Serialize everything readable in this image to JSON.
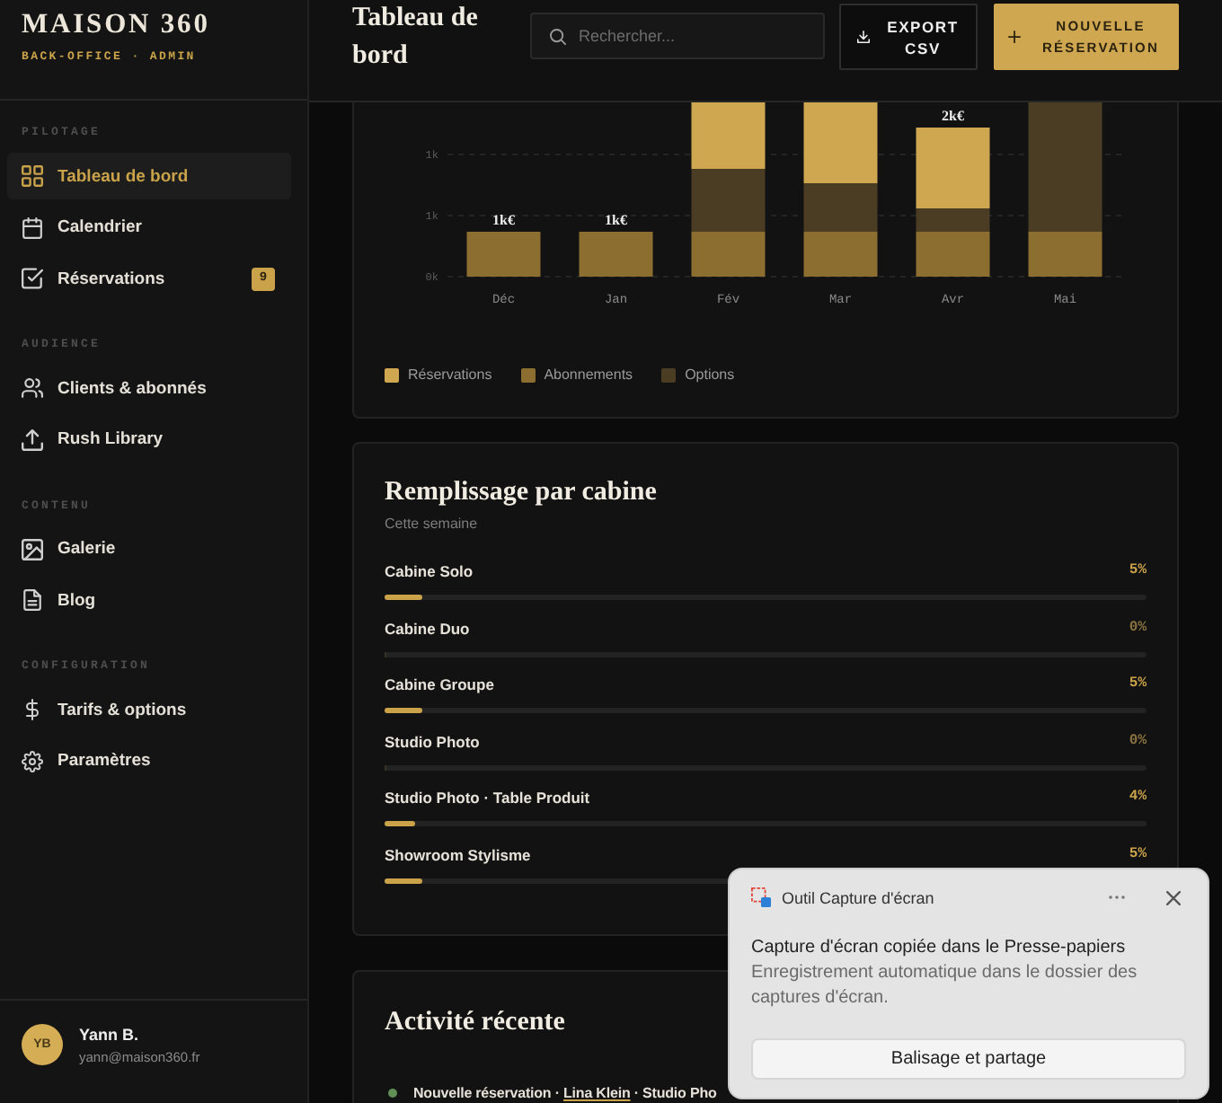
{
  "sidebar": {
    "logo": "MAISON 360",
    "subtitle": "BACK-OFFICE · ADMIN",
    "sections": [
      {
        "title": "PILOTAGE",
        "items": [
          {
            "label": "Tableau de bord",
            "selected": true
          },
          {
            "label": "Calendrier",
            "selected": false
          },
          {
            "label": "Réservations",
            "selected": false,
            "badge": "9"
          }
        ]
      },
      {
        "title": "AUDIENCE",
        "items": [
          {
            "label": "Clients & abonnés",
            "selected": false
          },
          {
            "label": "Rush Library",
            "selected": false
          }
        ]
      },
      {
        "title": "CONTENU",
        "items": [
          {
            "label": "Galerie",
            "selected": false
          },
          {
            "label": "Blog",
            "selected": false
          }
        ]
      },
      {
        "title": "CONFIGURATION",
        "items": [
          {
            "label": "Tarifs & options",
            "selected": false
          },
          {
            "label": "Paramètres",
            "selected": false
          }
        ]
      }
    ],
    "user": {
      "initials": "YB",
      "name": "Yann B.",
      "email": "yann@maison360.fr"
    }
  },
  "header": {
    "title": "Tableau de bord",
    "search": {
      "placeholder": "Rechercher..."
    },
    "buttons": [
      {
        "label": "EXPORT CSV",
        "kind": "export"
      },
      {
        "label": "NOUVELLE RÉSERVATION",
        "kind": "create"
      }
    ]
  },
  "revenue_chart": {
    "chart_data": {
      "type": "bar",
      "stacked": true,
      "categories": [
        "Déc",
        "Jan",
        "Fév",
        "Mar",
        "Avr",
        "Mai"
      ],
      "series": [
        {
          "name": "Réservations",
          "color": "#cfa750",
          "values": [
            0,
            0,
            740,
            900,
            900,
            0
          ]
        },
        {
          "name": "Abonnements",
          "color": "#8b6e30",
          "values": [
            500,
            500,
            500,
            500,
            500,
            500
          ]
        },
        {
          "name": "Options",
          "color": "#4a3d24",
          "values": [
            0,
            0,
            700,
            540,
            260,
            1440
          ]
        }
      ],
      "ylim": [
        0,
        1940
      ],
      "yticks": [
        {
          "value": 0,
          "label": "0k"
        },
        {
          "value": 680,
          "label": "1k"
        },
        {
          "value": 1360,
          "label": "1k"
        }
      ],
      "value_labels": [
        "1k€",
        "1k€",
        null,
        null,
        "2k€",
        null
      ]
    }
  },
  "occupancy": {
    "title": "Remplissage par cabine",
    "subtitle": "Cette semaine",
    "cabins": [
      {
        "name": "Cabine Solo",
        "reading": "5%",
        "level": 0.05
      },
      {
        "name": "Cabine Duo",
        "reading": "0%",
        "level": 0
      },
      {
        "name": "Cabine Groupe",
        "reading": "5%",
        "level": 0.05
      },
      {
        "name": "Studio Photo",
        "reading": "0%",
        "level": 0
      },
      {
        "name": "Studio Photo · Table Produit",
        "reading": "4%",
        "level": 0.04
      },
      {
        "name": "Showroom Stylisme",
        "reading": "5%",
        "level": 0.05
      }
    ]
  },
  "activity": {
    "title": "Activité récente",
    "items": [
      {
        "color": "#5f8f55",
        "text_before": "Nouvelle réservation ·",
        "link": "Lina Klein",
        "text_after": "· Studio Pho"
      }
    ]
  },
  "notification": {
    "app": "Outil Capture d'écran",
    "message": "Capture d'écran copiée dans le Presse-papiers",
    "detail": "Enregistrement automatique dans le dossier des captures d'écran.",
    "action": "Balisage et partage"
  }
}
